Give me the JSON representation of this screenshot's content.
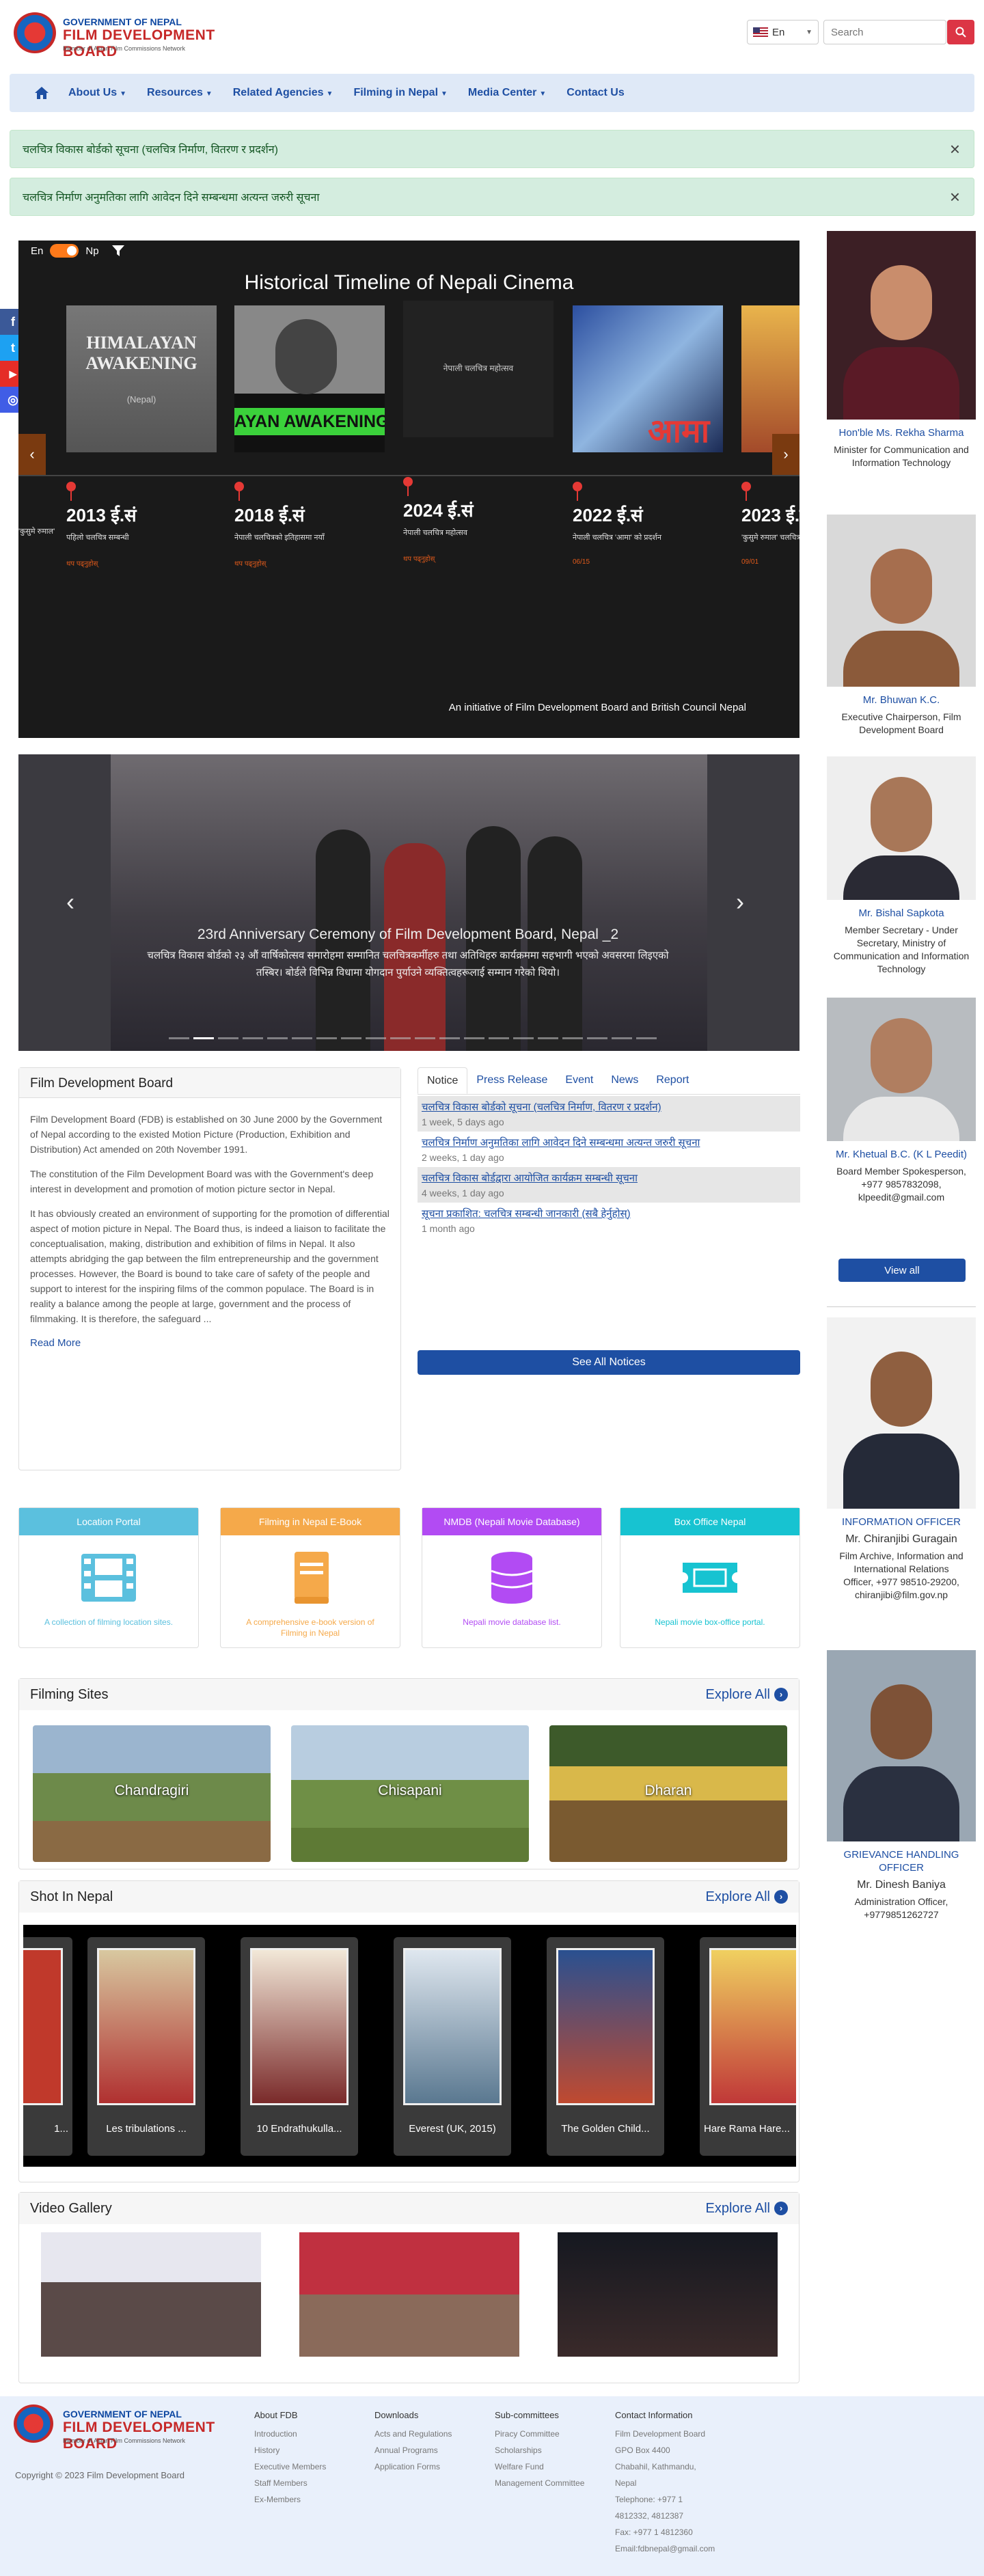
{
  "header": {
    "logo_line1": "GOVERNMENT OF NEPAL",
    "logo_line2": "FILM DEVELOPMENT BOARD",
    "logo_line3": "Member of Asian Film Commissions Network",
    "language": "En",
    "search_placeholder": "Search",
    "search_icon": "search-icon"
  },
  "nav": {
    "home_icon": "home-icon",
    "items": [
      "About Us",
      "Resources",
      "Related Agencies",
      "Filming in Nepal",
      "Media Center",
      "Contact Us"
    ]
  },
  "alerts": [
    {
      "text": "चलचित्र विकास बोर्डको सूचना (चलचित्र निर्माण, वितरण र प्रदर्शन)"
    },
    {
      "text": "चलचित्र निर्माण अनुमतिका लागि आवेदन दिने सम्बन्धमा अत्यन्त जरुरी सूचना"
    }
  ],
  "timeline": {
    "toggle_en": "En",
    "toggle_np": "Np",
    "title": "Historical Timeline of Nepali Cinema",
    "cards": [
      {
        "year": "2013 ई.सं",
        "text": "पहिलो चलचित्र सम्बन्धी",
        "link": "थप पढ्नुहोस्"
      },
      {
        "year": "2018 ई.सं",
        "text": "नेपाली चलचित्रको इतिहासमा नयाँ",
        "link": "थप पढ्नुहोस्"
      },
      {
        "year": "2024 ई.सं",
        "text": "नेपाली चलचित्र महोत्सव",
        "link": "थप पढ्नुहोस्"
      },
      {
        "year": "2022 ई.सं",
        "text": "नेपाली चलचित्र 'आमा' को प्रदर्शन",
        "link": "06/15"
      },
      {
        "year": "2023 ई.सं",
        "text": "'कुसुमे रुमाल' चलचित्र",
        "link": "09/01"
      }
    ],
    "left_text": "'कुसुमे रुमाल'",
    "footer": "An initiative of Film Development Board and British Council Nepal",
    "arrow_left": "‹",
    "arrow_right": "›"
  },
  "social": {
    "facebook": "f",
    "twitter": "t",
    "youtube": "▶",
    "instagram": "◎"
  },
  "carousel": {
    "caption_title": "23rd Anniversary Ceremony of Film Development Board, Nepal _2",
    "caption_text": "चलचित्र विकास बोर्डको २३ औं वार्षिकोत्सव समारोहमा सम्मानित चलचित्रकर्मीहरु तथा अतिथिहरु कार्यक्रममा सहभागी भएको अवसरमा लिइएको तस्बिर। बोर्डले विभिन्न विधामा योगदान पुर्याउने व्यक्तित्वहरूलाई सम्मान गरेको थियो।",
    "prev": "‹",
    "next": "›"
  },
  "fdb": {
    "title": "Film Development Board",
    "p1": "Film Development Board (FDB) is established on 30 June 2000 by the Government of Nepal according to the existed Motion Picture (Production, Exhibition and Distribution) Act amended on 20th November 1991.",
    "p2": "The constitution of the Film Development Board was with the Government's deep interest in development and promotion of motion picture sector in Nepal.",
    "p3": "It has obviously created an environment of supporting for the promotion of differential aspect of motion picture in Nepal. The Board thus, is indeed a liaison to facilitate the conceptualisation, making, distribution and exhibition of films in Nepal. It also attempts abridging the gap between the film entrepreneurship and the government processes. However, the Board is bound to take care of safety of the people and support to interest for the inspiring films of the common populace. The Board is in reality a balance among the people at large, government and the process of filmmaking. It is therefore, the safeguard ...",
    "read_more": "Read More"
  },
  "notice": {
    "tabs": [
      "Notice",
      "Press Release",
      "Event",
      "News",
      "Report"
    ],
    "items": [
      {
        "title": "चलचित्र विकास बोर्डको सूचना (चलचित्र निर्माण, वितरण र प्रदर्शन)",
        "time": "1 week, 5 days ago"
      },
      {
        "title": "चलचित्र निर्माण अनुमतिका लागि आवेदन दिने सम्बन्धमा अत्यन्त जरुरी सूचना",
        "time": "2 weeks, 1 day ago"
      },
      {
        "title": "चलचित्र विकास बोर्डद्वारा आयोजित कार्यक्रम सम्बन्धी सूचना",
        "time": "4 weeks, 1 day ago"
      },
      {
        "title": "सूचना प्रकाशित: चलचित्र सम्बन्धी जानकारी (सबै हेर्नुहोस्)",
        "time": "1 month ago"
      }
    ],
    "see_all": "See All Notices"
  },
  "members": [
    {
      "name": "Hon'ble Ms. Rekha Sharma",
      "role": "Minister for Communication and Information Technology"
    },
    {
      "name": "Mr. Bhuwan K.C.",
      "role": "Executive Chairperson, Film Development Board"
    },
    {
      "name": "Mr. Bishal Sapkota",
      "role": "Member Secretary - Under Secretary, Ministry of Communication and Information Technology"
    },
    {
      "name": "Mr. Khetual B.C. (K L Peedit)",
      "role": "Board Member Spokesperson, +977 9857832098, klpeedit@gmail.com"
    }
  ],
  "view_all": "View all",
  "info_officer": {
    "heading": "INFORMATION OFFICER",
    "name": "Mr. Chiranjibi Guragain",
    "role": "Film Archive, Information and International Relations Officer, +977 98510-29200, chiranjibi@film.gov.np"
  },
  "grievance_officer": {
    "heading": "GRIEVANCE HANDLING OFFICER",
    "name": "Mr. Dinesh Baniya",
    "role": "Administration Officer, +9779851262727"
  },
  "portals": [
    {
      "title": "Location Portal",
      "desc": "A collection of filming location sites.",
      "color": "#5bc0de",
      "icon": "film-icon"
    },
    {
      "title": "Filming in Nepal E-Book",
      "desc": "A comprehensive e-book version of Filming in Nepal",
      "color": "#f5a94a",
      "icon": "book-icon"
    },
    {
      "title": "NMDB (Nepali Movie Database)",
      "desc": "Nepali movie database list.",
      "color": "#b24bf3",
      "icon": "database-icon"
    },
    {
      "title": "Box Office Nepal",
      "desc": "Nepali movie box-office portal.",
      "color": "#17c3d1",
      "icon": "ticket-icon"
    }
  ],
  "filming_sites": {
    "title": "Filming Sites",
    "explore": "Explore All",
    "sites": [
      "Chandragiri",
      "Chisapani",
      "Dharan"
    ]
  },
  "shot_in_nepal": {
    "title": "Shot In Nepal",
    "explore": "Explore All",
    "movies": [
      "1...",
      "Les tribulations ...",
      "10 Endrathukulla...",
      "Everest (UK, 2015)",
      "The Golden Child...",
      "Hare Rama Hare..."
    ]
  },
  "video_gallery": {
    "title": "Video Gallery",
    "explore": "Explore All"
  },
  "footer": {
    "copyright": "Copyright © 2023 Film Development Board",
    "cols": [
      {
        "title": "About FDB",
        "items": [
          "Introduction",
          "History",
          "Executive Members",
          "Staff Members",
          "Ex-Members"
        ]
      },
      {
        "title": "Downloads",
        "items": [
          "Acts and Regulations",
          "Annual Programs",
          "Application Forms"
        ]
      },
      {
        "title": "Sub-committees",
        "items": [
          "Piracy Committee",
          "Scholarships",
          "Welfare Fund",
          "Management Committee"
        ]
      },
      {
        "title": "Contact Information",
        "items": [
          "Film Development Board",
          "GPO Box 4400",
          "Chabahil, Kathmandu,",
          "Nepal",
          "Telephone: +977 1",
          "4812332, 4812387",
          "Fax: +977 1 4812360",
          "Email:fdbnepal@gmail.com"
        ]
      }
    ]
  }
}
